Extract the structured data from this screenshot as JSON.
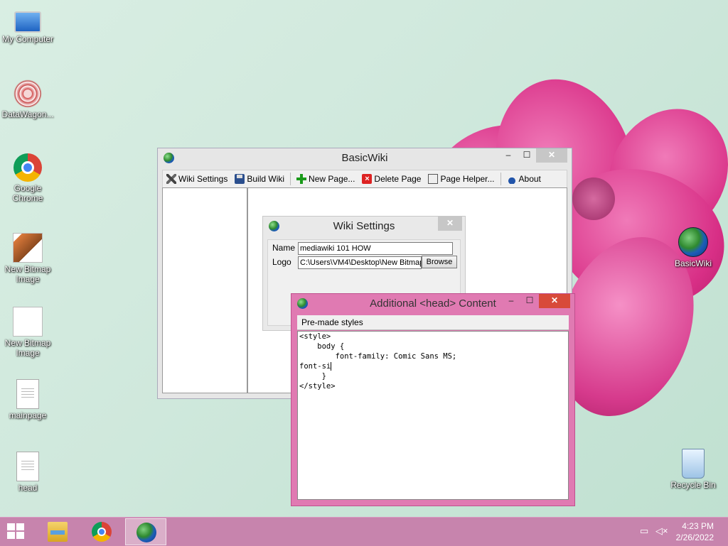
{
  "desktop": {
    "icons": [
      {
        "label": "My Computer",
        "icon": "computer-icon"
      },
      {
        "label": "DataWagon...",
        "icon": "datawagon-icon"
      },
      {
        "label": "Google Chrome",
        "icon": "chrome-icon"
      },
      {
        "label": "New Bitmap Image",
        "icon": "bitmap-image-icon"
      },
      {
        "label": "New Bitmap Image",
        "icon": "bitmap-image-icon"
      },
      {
        "label": "mainpage",
        "icon": "text-document-icon"
      },
      {
        "label": "head",
        "icon": "text-document-icon"
      },
      {
        "label": "BasicWiki",
        "icon": "globe-icon"
      },
      {
        "label": "Recycle Bin",
        "icon": "recycle-bin-icon"
      }
    ]
  },
  "basicwiki": {
    "title": "BasicWiki",
    "controls": {
      "minimize": "–",
      "maximize": "☐",
      "close": "✕"
    },
    "toolbar": [
      {
        "label": "Wiki Settings",
        "icon": "wrench-icon"
      },
      {
        "label": "Build Wiki",
        "icon": "floppy-disk-icon"
      },
      {
        "label": "New Page...",
        "icon": "plus-icon"
      },
      {
        "label": "Delete Page",
        "icon": "delete-icon"
      },
      {
        "label": "Page Helper...",
        "icon": "page-helper-icon"
      },
      {
        "label": "About",
        "icon": "about-icon"
      }
    ]
  },
  "wiki_settings": {
    "title": "Wiki Settings",
    "close": "✕",
    "name_label": "Name",
    "name_value": "mediawiki 101 HOW",
    "logo_label": "Logo",
    "logo_value": "C:\\Users\\VM4\\Desktop\\New Bitmap",
    "browse_label": "Browse"
  },
  "head_content": {
    "title": "Additional <head> Content",
    "controls": {
      "minimize": "–",
      "maximize": "☐",
      "close": "✕"
    },
    "menu": "Pre-made styles",
    "editor_lines": [
      "<style>",
      "    body {",
      "        font-family: Comic Sans MS;",
      "font-si",
      "     }",
      "</style>"
    ]
  },
  "taskbar": {
    "time": "4:23 PM",
    "date": "2/26/2022",
    "network_icon": "network-icon",
    "volume_icon": "volume-muted-icon"
  }
}
